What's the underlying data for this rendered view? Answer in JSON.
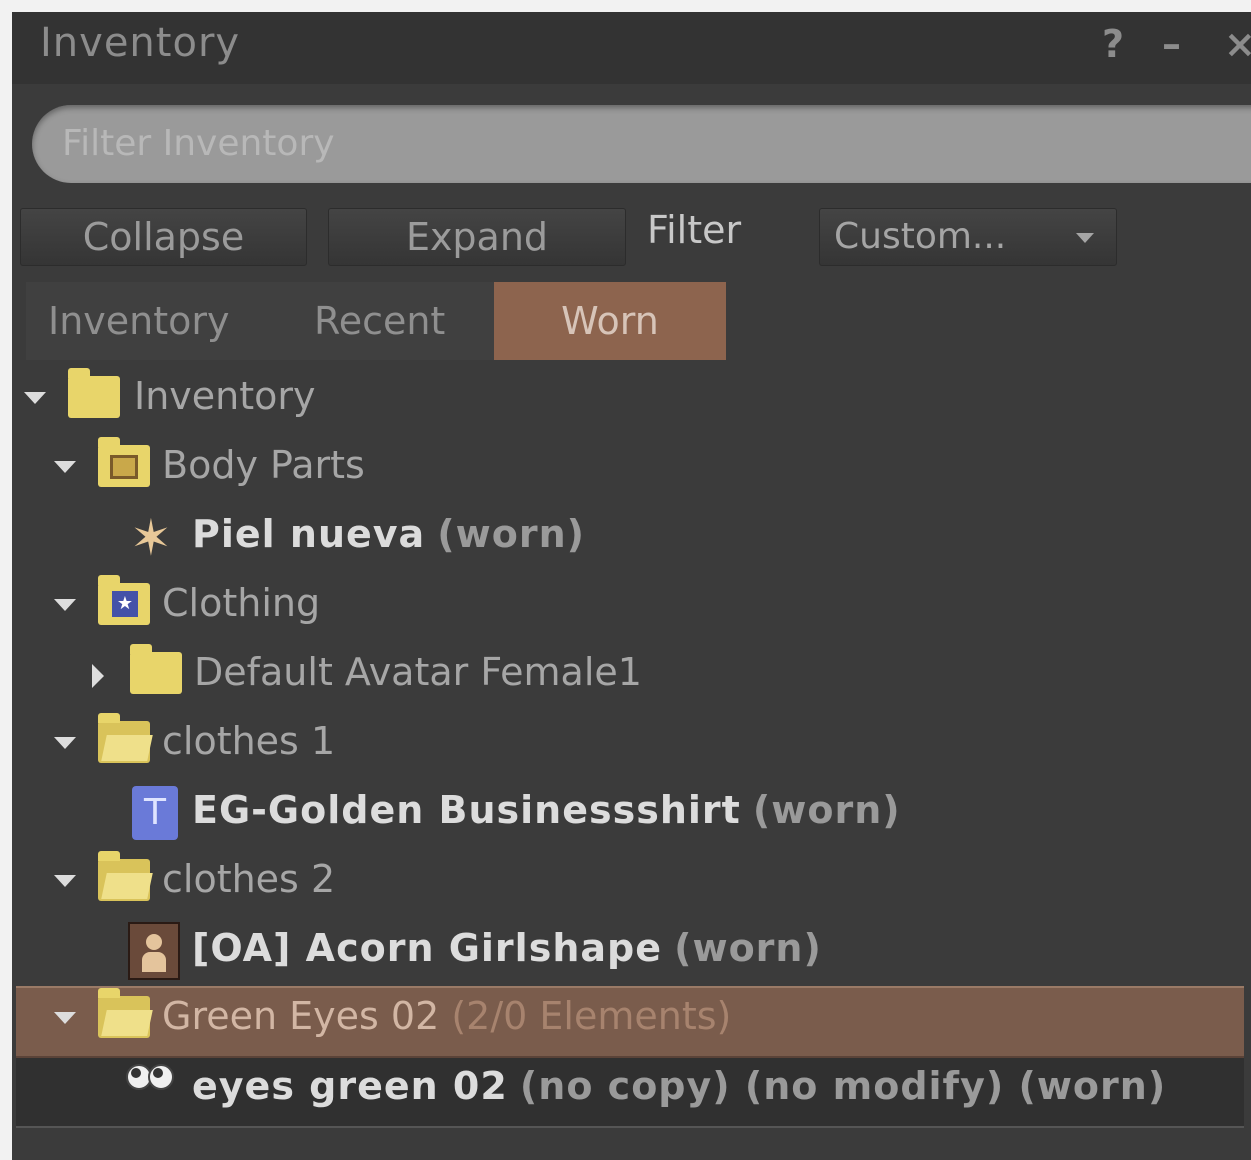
{
  "window": {
    "title": "Inventory",
    "help": "?",
    "minimize": "–",
    "close": "×"
  },
  "search": {
    "placeholder": "Filter Inventory"
  },
  "toolbar": {
    "collapse": "Collapse",
    "expand": "Expand",
    "filter": "Filter",
    "dropdown": "Custom..."
  },
  "tabs": [
    {
      "label": "Inventory"
    },
    {
      "label": "Recent"
    },
    {
      "label": "Worn",
      "active": true
    }
  ],
  "tree": [
    {
      "label": "Inventory",
      "icon": "folder-icon"
    },
    {
      "label": "Body Parts",
      "icon": "body-parts-folder-icon"
    },
    {
      "label": "Piel nueva",
      "suffix": "(worn)",
      "icon": "skin-icon"
    },
    {
      "label": "Clothing",
      "icon": "clothing-folder-icon"
    },
    {
      "label": "Default Avatar Female1",
      "icon": "folder-icon"
    },
    {
      "label": "clothes 1",
      "icon": "open-folder-icon"
    },
    {
      "label": "EG-Golden Businessshirt",
      "suffix": "(worn)",
      "icon": "shirt-icon"
    },
    {
      "label": "clothes 2",
      "icon": "open-folder-icon"
    },
    {
      "label": "[OA] Acorn Girlshape",
      "suffix": "(worn)",
      "icon": "shape-icon"
    },
    {
      "label": "Green Eyes 02",
      "count": "(2/0 Elements)",
      "icon": "open-folder-icon"
    },
    {
      "label": "eyes green 02",
      "suffix": "(no copy) (no modify) (worn)",
      "icon": "eyes-icon"
    }
  ],
  "colors": {
    "panel_bg": "#3b3b3b",
    "active_tab": "#8d644e",
    "selected_row": "#7a5c4c",
    "folder": "#e8d56a"
  }
}
